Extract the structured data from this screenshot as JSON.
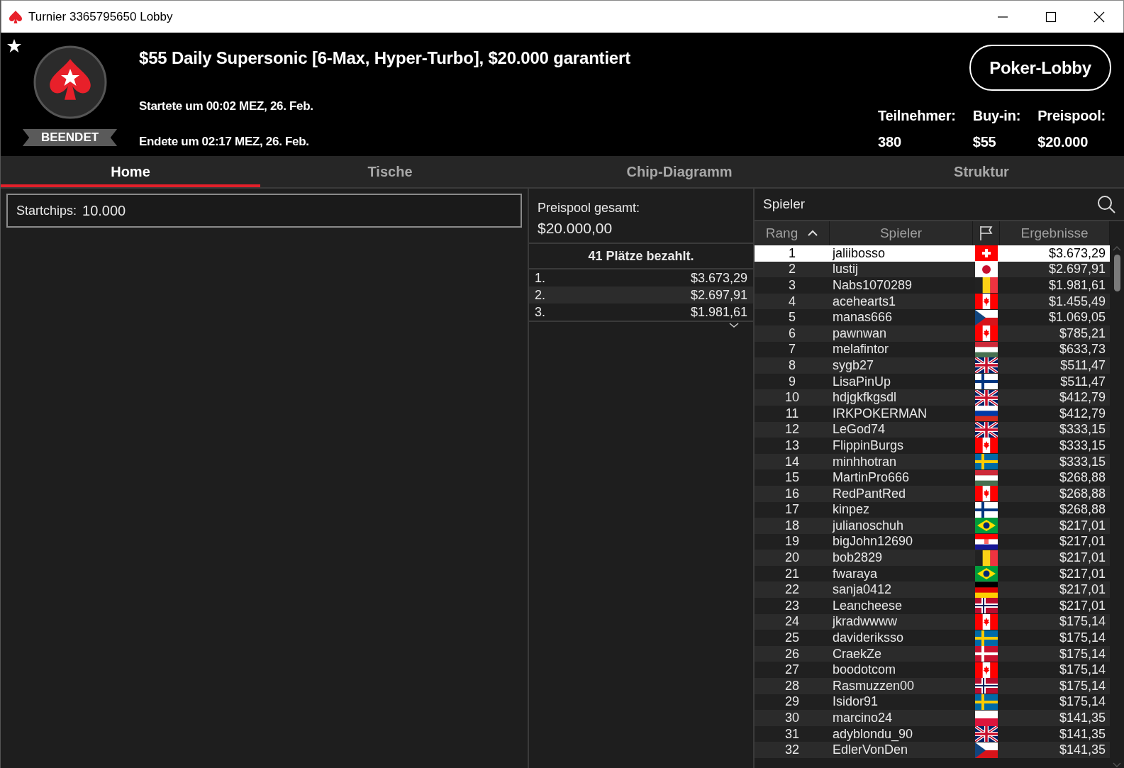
{
  "window": {
    "title": "Turnier 3365795650 Lobby"
  },
  "header": {
    "title": "$55 Daily Supersonic [6-Max, Hyper-Turbo], $20.000 garantiert",
    "status": "BEENDET",
    "started": "Startete um 00:02 MEZ, 26. Feb.",
    "ended": "Endete um 02:17 MEZ, 26. Feb.",
    "lobby_button": "Poker-Lobby",
    "stats": [
      {
        "label": "Teilnehmer:",
        "value": "380"
      },
      {
        "label": "Buy-in:",
        "value": "$55"
      },
      {
        "label": "Preispool:",
        "value": "$20.000"
      }
    ]
  },
  "tabs": [
    {
      "label": "Home",
      "selected": true
    },
    {
      "label": "Tische",
      "selected": false
    },
    {
      "label": "Chip-Diagramm",
      "selected": false
    },
    {
      "label": "Struktur",
      "selected": false
    }
  ],
  "start_chips": {
    "label": "Startchips:",
    "value": "10.000"
  },
  "prize_pool": {
    "label": "Preispool gesamt:",
    "value": "$20.000,00",
    "paid_places": "41 Plätze bezahlt.",
    "payouts": [
      {
        "place": "1.",
        "amount": "$3.673,29"
      },
      {
        "place": "2.",
        "amount": "$2.697,91"
      },
      {
        "place": "3.",
        "amount": "$1.981,61"
      }
    ]
  },
  "players": {
    "search_label": "Spieler",
    "columns": [
      {
        "kind": "text",
        "label": "Rang",
        "sorted": true
      },
      {
        "kind": "text",
        "label": "Spieler",
        "sorted": false
      },
      {
        "kind": "flag",
        "sorted": false
      },
      {
        "kind": "text",
        "label": "Ergebnisse",
        "sorted": false
      }
    ],
    "rows": [
      {
        "rank": "1",
        "name": "jaliibosso",
        "kind": "ch",
        "result": "$3.673,29",
        "selected": true
      },
      {
        "rank": "2",
        "name": "lustij",
        "kind": "jp",
        "result": "$2.697,91",
        "selected": false
      },
      {
        "rank": "3",
        "name": "Nabs1070289",
        "kind": "be",
        "result": "$1.981,61",
        "selected": false
      },
      {
        "rank": "4",
        "name": "acehearts1",
        "kind": "ca",
        "result": "$1.455,49",
        "selected": false
      },
      {
        "rank": "5",
        "name": "manas666",
        "kind": "cz",
        "result": "$1.069,05",
        "selected": false
      },
      {
        "rank": "6",
        "name": "pawnwan",
        "kind": "ca",
        "result": "$785,21",
        "selected": false
      },
      {
        "rank": "7",
        "name": "melafintor",
        "kind": "hu",
        "result": "$633,73",
        "selected": false
      },
      {
        "rank": "8",
        "name": "sygb27",
        "kind": "gb",
        "result": "$511,47",
        "selected": false
      },
      {
        "rank": "9",
        "name": "LisaPinUp",
        "kind": "fi",
        "result": "$511,47",
        "selected": false
      },
      {
        "rank": "10",
        "name": "hdjgkfkgsdl",
        "kind": "gb",
        "result": "$412,79",
        "selected": false
      },
      {
        "rank": "11",
        "name": "IRKPOKERMAN",
        "kind": "ru",
        "result": "$412,79",
        "selected": false
      },
      {
        "rank": "12",
        "name": "LeGod74",
        "kind": "gb",
        "result": "$333,15",
        "selected": false
      },
      {
        "rank": "13",
        "name": "FlippinBurgs",
        "kind": "ca",
        "result": "$333,15",
        "selected": false
      },
      {
        "rank": "14",
        "name": "minhhotran",
        "kind": "se",
        "result": "$333,15",
        "selected": false
      },
      {
        "rank": "15",
        "name": "MartinPro666",
        "kind": "hu",
        "result": "$268,88",
        "selected": false
      },
      {
        "rank": "16",
        "name": "RedPantRed",
        "kind": "ca",
        "result": "$268,88",
        "selected": false
      },
      {
        "rank": "17",
        "name": "kinpez",
        "kind": "fi",
        "result": "$268,88",
        "selected": false
      },
      {
        "rank": "18",
        "name": "julianoschuh",
        "kind": "br",
        "result": "$217,01",
        "selected": false
      },
      {
        "rank": "19",
        "name": "bigJohn12690",
        "kind": "hr",
        "result": "$217,01",
        "selected": false
      },
      {
        "rank": "20",
        "name": "bob2829",
        "kind": "be",
        "result": "$217,01",
        "selected": false
      },
      {
        "rank": "21",
        "name": "fwaraya",
        "kind": "br",
        "result": "$217,01",
        "selected": false
      },
      {
        "rank": "22",
        "name": "sanja0412",
        "kind": "de",
        "result": "$217,01",
        "selected": false
      },
      {
        "rank": "23",
        "name": "Leancheese",
        "kind": "no",
        "result": "$217,01",
        "selected": false
      },
      {
        "rank": "24",
        "name": "jkradwwww",
        "kind": "ca",
        "result": "$175,14",
        "selected": false
      },
      {
        "rank": "25",
        "name": "davideriksso",
        "kind": "se",
        "result": "$175,14",
        "selected": false
      },
      {
        "rank": "26",
        "name": "CraekZe",
        "kind": "dk",
        "result": "$175,14",
        "selected": false
      },
      {
        "rank": "27",
        "name": "boodotcom",
        "kind": "ca",
        "result": "$175,14",
        "selected": false
      },
      {
        "rank": "28",
        "name": "Rasmuzzen00",
        "kind": "no",
        "result": "$175,14",
        "selected": false
      },
      {
        "rank": "29",
        "name": "Isidor91",
        "kind": "se",
        "result": "$175,14",
        "selected": false
      },
      {
        "rank": "30",
        "name": "marcino24",
        "kind": "pl",
        "result": "$141,35",
        "selected": false
      },
      {
        "rank": "31",
        "name": "adyblondu_90",
        "kind": "gb",
        "result": "$141,35",
        "selected": false
      },
      {
        "rank": "32",
        "name": "EdlerVonDen",
        "kind": "cz",
        "result": "$141,35",
        "selected": false
      }
    ]
  }
}
